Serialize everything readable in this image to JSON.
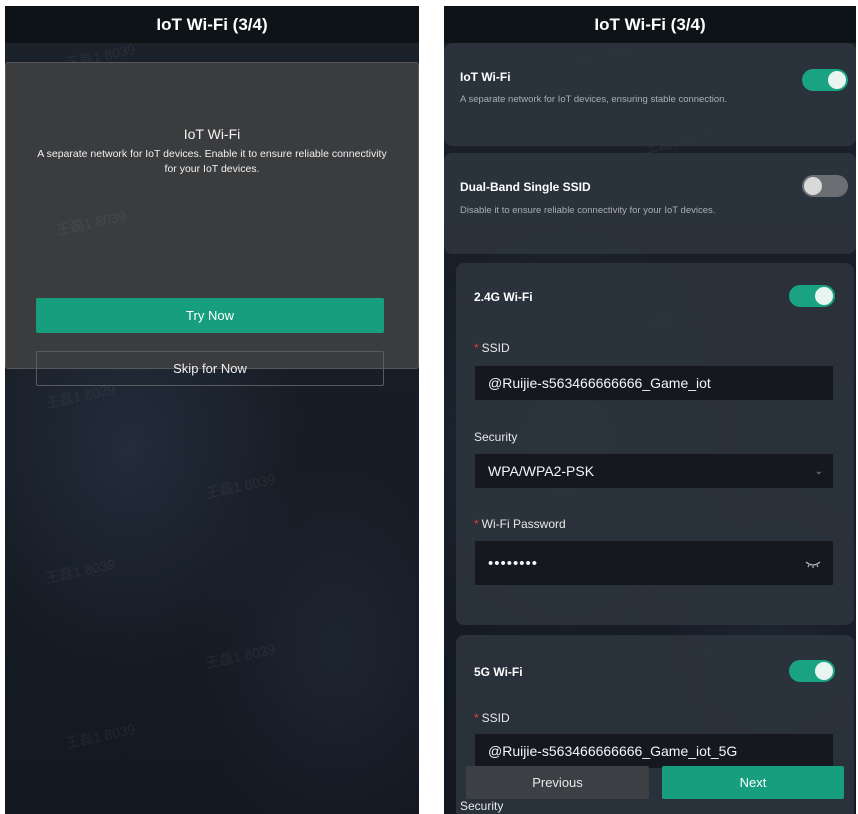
{
  "left_screen": {
    "title": "IoT Wi-Fi (3/4)",
    "modal": {
      "title": "IoT Wi-Fi",
      "description": "A separate network for IoT devices. Enable it to ensure reliable connectivity for your IoT devices.",
      "primary_button": "Try Now",
      "secondary_button": "Skip for Now"
    }
  },
  "right_screen": {
    "title": "IoT Wi-Fi (3/4)",
    "iot_wifi": {
      "title": "IoT Wi-Fi",
      "description": "A separate network for IoT devices, ensuring stable connection.",
      "enabled": true
    },
    "dual_band": {
      "title": "Dual-Band Single SSID",
      "description": "Disable it to ensure reliable connectivity for your IoT devices.",
      "enabled": false
    },
    "wifi_24g": {
      "title": "2.4G Wi-Fi",
      "enabled": true,
      "ssid_label": "SSID",
      "ssid_value": "@Ruijie-s563466666666_Game_iot",
      "security_label": "Security",
      "security_value": "WPA/WPA2-PSK",
      "password_label": "Wi-Fi Password",
      "password_value": "••••••••"
    },
    "wifi_5g": {
      "title": "5G Wi-Fi",
      "enabled": true,
      "ssid_label": "SSID",
      "ssid_value": "@Ruijie-s563466666666_Game_iot_5G",
      "security_label": "Security"
    },
    "footer": {
      "previous_button": "Previous",
      "next_button": "Next"
    }
  },
  "watermark_text": "王磊1 8039",
  "colors": {
    "accent": "#169e7f",
    "background": "#171d26",
    "required": "#e0413c"
  }
}
